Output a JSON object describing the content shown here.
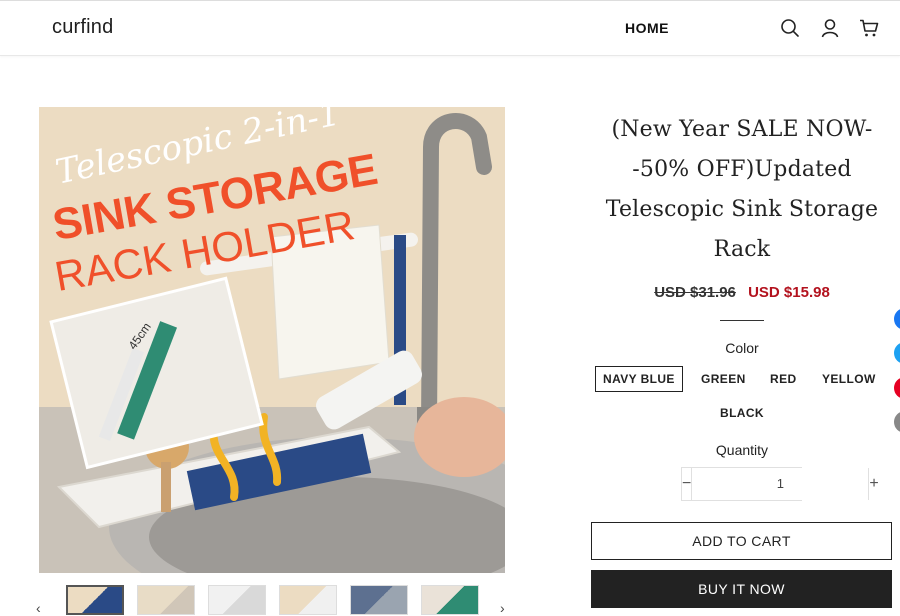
{
  "header": {
    "logo": "curfind",
    "nav": [
      "HOME"
    ],
    "icons": [
      "search-icon",
      "account-icon",
      "cart-icon"
    ]
  },
  "product": {
    "image_text": {
      "line1": "Telescopic 2-in-1",
      "line2": "SINK STORAGE",
      "line3": "RACK HOLDER",
      "measure": "45cm"
    },
    "title": "(New Year SALE NOW--50% OFF)Updated Telescopic Sink Storage Rack",
    "price_old": "USD $31.96",
    "price_new": "USD $15.98",
    "color_label": "Color",
    "colors": [
      "NAVY BLUE",
      "GREEN",
      "RED",
      "YELLOW",
      "BLACK"
    ],
    "selected_color": "NAVY BLUE",
    "quantity_label": "Quantity",
    "quantity": "1",
    "add_to_cart": "ADD TO CART",
    "buy_now": "BUY IT NOW"
  },
  "thumbnails_count": 6,
  "colors_theme": {
    "sale_red": "#b3121e",
    "dark": "#222222",
    "rack_blue": "#2a4a86",
    "title_orange": "#f0502a"
  },
  "share_colors": [
    "#1877f2",
    "#1da1f2",
    "#e60023",
    "#888888"
  ]
}
